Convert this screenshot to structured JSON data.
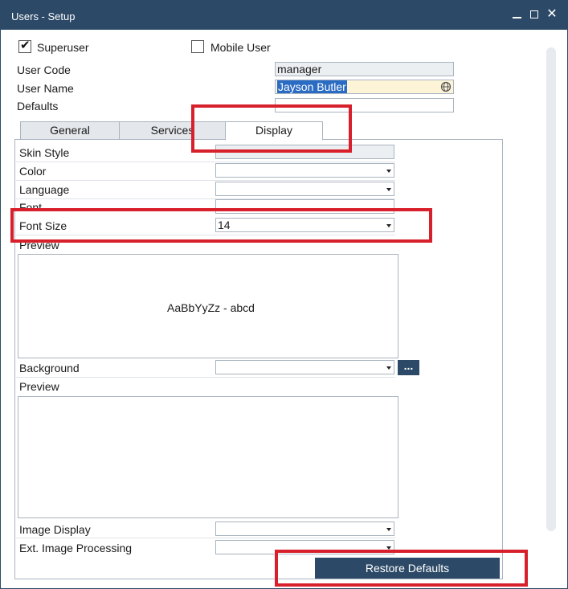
{
  "window": {
    "title": "Users - Setup"
  },
  "checkboxes": {
    "superuser": {
      "label": "Superuser",
      "checked": true
    },
    "mobile_user": {
      "label": "Mobile User",
      "checked": false
    }
  },
  "form": {
    "user_code_label": "User Code",
    "user_code_value": "manager",
    "user_name_label": "User Name",
    "user_name_value": "Jayson Butler",
    "defaults_label": "Defaults",
    "defaults_value": ""
  },
  "tabs": [
    {
      "label": "General",
      "active": false
    },
    {
      "label": "Services",
      "active": false
    },
    {
      "label": "Display",
      "active": true
    }
  ],
  "display": {
    "skin_style_label": "Skin Style",
    "color_label": "Color",
    "language_label": "Language",
    "font_label": "Font",
    "font_size_label": "Font Size",
    "font_size_value": "14",
    "preview_label": "Preview",
    "preview_sample": "AaBbYyZz - abcd",
    "background_label": "Background",
    "background_button": "...",
    "preview2_label": "Preview",
    "image_display_label": "Image Display",
    "ext_image_processing_label": "Ext. Image Processing"
  },
  "buttons": {
    "restore_defaults": "Restore Defaults"
  },
  "colors": {
    "accent": "#2c4a67",
    "annotation": "#d8202c",
    "selection": "#2a6bc3"
  }
}
